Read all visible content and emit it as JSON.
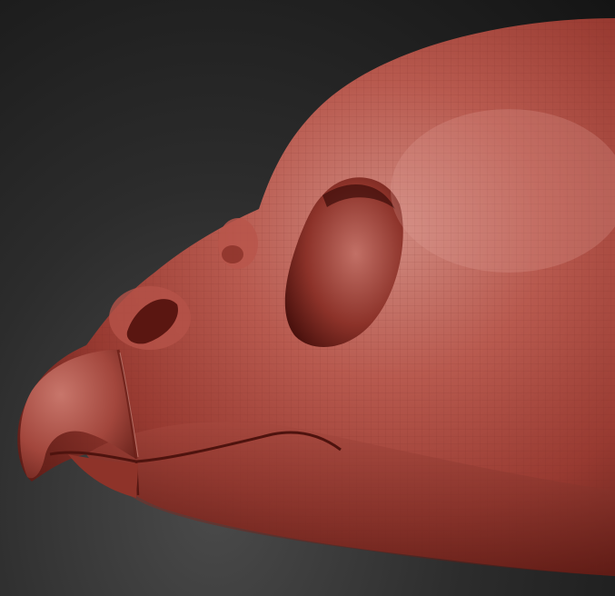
{
  "scene": {
    "colors": {
      "background_dark": "#141414",
      "background_light": "#4a4a4a",
      "clay_base": "#a8443b",
      "clay_highlight": "#d9938a",
      "clay_shadow": "#5a1712",
      "wire_line": "#7a2a24"
    }
  }
}
